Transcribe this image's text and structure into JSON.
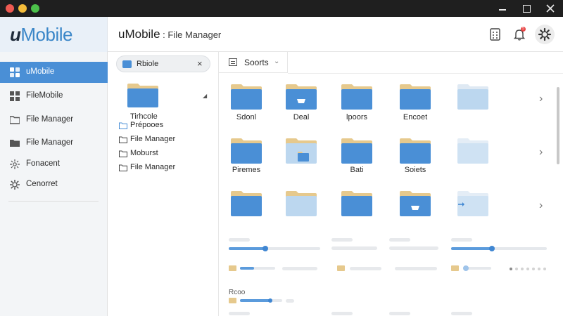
{
  "window": {
    "controls": [
      "minimize",
      "maximize",
      "close"
    ]
  },
  "header": {
    "brand_u": "u",
    "brand_rest": "Mobile",
    "title_main": "uMobile",
    "title_sub": " : File Manager",
    "notification_count": "5"
  },
  "sidebar": {
    "items": [
      {
        "label": "uMobile",
        "icon": "app-icon",
        "active": true
      },
      {
        "label": "FileMobile",
        "icon": "grid-icon"
      },
      {
        "label": "File Manager",
        "icon": "folder-icon"
      },
      {
        "label": "File Manager",
        "icon": "folder-icon"
      },
      {
        "label": "Fonacent",
        "icon": "network-icon"
      },
      {
        "label": "Cenorret",
        "icon": "gear-icon"
      }
    ]
  },
  "tree": {
    "chip_label": "Rbiole",
    "chip_close": "×",
    "folder_title_1": "Tirhcole",
    "rows": [
      {
        "label": "Prépooes",
        "icon": "folder-outline-blue-icon"
      },
      {
        "label": "File Manager",
        "icon": "folder-outline-icon"
      },
      {
        "label": "Moburst",
        "icon": "folder-outline-icon"
      },
      {
        "label": "File Manager",
        "icon": "folder-outline-icon"
      }
    ]
  },
  "main": {
    "sort_label": "Soorts",
    "folder_rows": [
      {
        "labels": [
          "Sdonl",
          "Deal",
          "lpoors",
          "Encoet",
          ""
        ]
      },
      {
        "labels": [
          "Piremes",
          "",
          "Bati",
          "Soiets",
          ""
        ]
      },
      {
        "labels": [
          "",
          "",
          "",
          "",
          ""
        ]
      }
    ],
    "bottom_label": "Rcoo",
    "progress": [
      0.38,
      0.4,
      0.42
    ]
  },
  "colors": {
    "accent": "#4a8fd6",
    "folder_blue": "#4a8fd6",
    "folder_light": "#bcd7ef",
    "folder_tab": "#e6c98d",
    "titlebar": "#1f1f1f"
  }
}
